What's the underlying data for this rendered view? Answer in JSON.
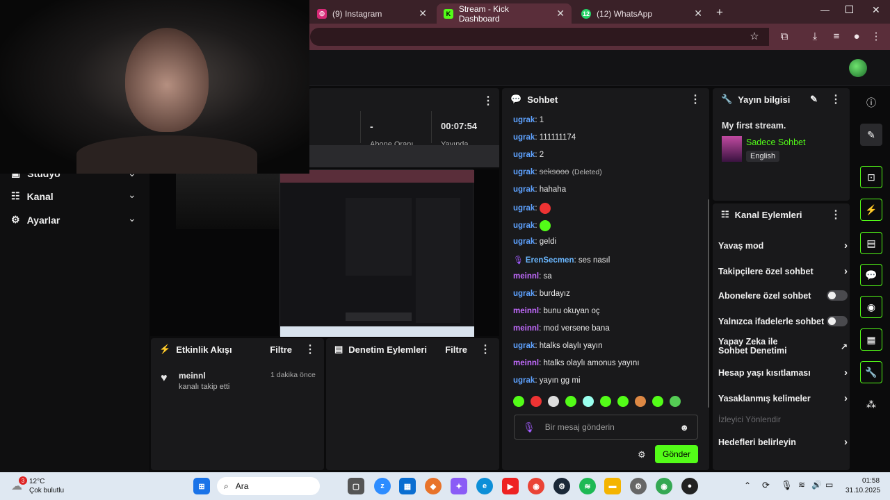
{
  "tabs": [
    {
      "label": "(9) Instagram",
      "color": "#d62976",
      "glyph": "◎"
    },
    {
      "label": "Stream - Kick Dashboard",
      "color": "#53fc18",
      "glyph": "K"
    },
    {
      "label": "(12) WhatsApp",
      "color": "#25d366",
      "glyph": "12"
    }
  ],
  "stats": {
    "dash": "-",
    "timer": "00:07:54",
    "sub1": "Abone Oranı",
    "sub2": "Yayında"
  },
  "sidebar": {
    "items": [
      {
        "label": "Stüdyo"
      },
      {
        "label": "Kanal"
      },
      {
        "label": "Ayarlar"
      }
    ]
  },
  "chat": {
    "title": "Sohbet",
    "messages": [
      {
        "user": "ugrak",
        "text": "1"
      },
      {
        "user": "ugrak",
        "text": "111111174"
      },
      {
        "user": "ugrak",
        "text": "2"
      },
      {
        "user": "ugrak",
        "text": "seksooo",
        "note": "(Deleted)"
      },
      {
        "user": "ugrak",
        "text": "hahaha"
      },
      {
        "user": "ugrak",
        "text": ""
      },
      {
        "user": "ugrak",
        "text": ""
      },
      {
        "user": "ugrak",
        "text": "geldi"
      },
      {
        "user": "ErenSecmen",
        "text": "ses nasıl"
      },
      {
        "user": "meinnl",
        "text": "sa"
      },
      {
        "user": "ugrak",
        "text": "burdayız"
      },
      {
        "user": "meinnl",
        "text": "bunu okuyan oç"
      },
      {
        "user": "meinnl",
        "text": "mod versene bana"
      },
      {
        "user": "ugrak",
        "text": "htalks olaylı yayın"
      },
      {
        "user": "meinnl",
        "text": "htalks olaylı amonus yayını"
      },
      {
        "user": "ugrak",
        "text": "yayın gg mi"
      }
    ],
    "placeholder": "Bir mesaj gönderin",
    "send": "Gönder"
  },
  "stream_info": {
    "title": "Yayın bilgisi",
    "stream_title": "My first stream.",
    "category": "Sadece Sohbet",
    "language": "English"
  },
  "channel_actions": {
    "title": "Kanal Eylemleri",
    "items": [
      {
        "label": "Yavaş mod",
        "kind": "arrow"
      },
      {
        "label": "Takipçilere özel sohbet",
        "kind": "arrow"
      },
      {
        "label": "Abonelere özel sohbet",
        "kind": "toggle"
      },
      {
        "label": "Yalnızca ifadelerle sohbet",
        "kind": "toggle"
      },
      {
        "label": "Yapay Zeka ile Sohbet Denetimi",
        "kind": "external"
      },
      {
        "label": "Hesap yaşı kısıtlaması",
        "kind": "arrow"
      },
      {
        "label": "Yasaklanmış kelimeler",
        "kind": "arrow"
      }
    ],
    "section": "İzleyici Yönlendir",
    "goals": "Hedefleri belirleyin"
  },
  "activity": {
    "title": "Etkinlik Akışı",
    "filter": "Filtre",
    "user": "meinnl",
    "event": "kanalı takip etti",
    "time": "1 dakika önce"
  },
  "moderation": {
    "title": "Denetim Eylemleri",
    "filter": "Filtre"
  },
  "taskbar": {
    "temp": "12°C",
    "weather": "Çok bulutlu",
    "badge": "3",
    "search": "Ara",
    "time": "01:58",
    "date": "31.10.2025"
  }
}
